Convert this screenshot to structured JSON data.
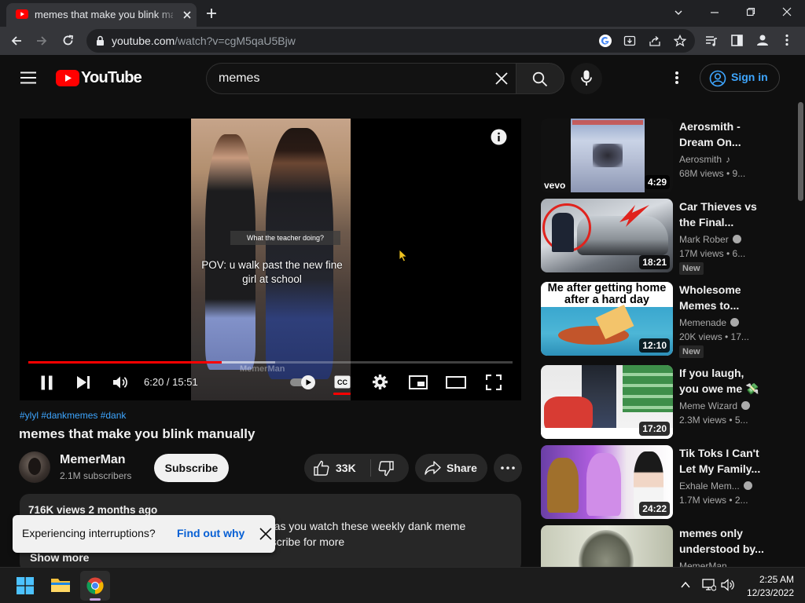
{
  "browser": {
    "tab_title": "memes that make you blink manually - YouTube",
    "url_host": "youtube.com",
    "url_path": "/watch?v=cgM5qaU5Bjw"
  },
  "youtube": {
    "logo_text": "YouTube",
    "search_query": "memes",
    "signin_label": "Sign in"
  },
  "player": {
    "caption_top": "What the teacher doing?",
    "caption_main": "POV: u walk past the new fine girl at school",
    "watermark": "MemerMan",
    "time_current": "6:20",
    "time_total": "15:51",
    "time_label": "6:20 / 15:51",
    "progress_fraction": 0.4,
    "buffer_fraction": 0.51,
    "cc_enabled": true
  },
  "video": {
    "hashtags": "#ylyl #dankmemes #dank",
    "title": "memes that make you blink manually",
    "channel_name": "MemerMan",
    "subscribers": "2.1M subscribers",
    "subscribe_label": "Subscribe",
    "like_count": "33K",
    "share_label": "Share",
    "desc_meta": "716K views  2 months ago",
    "desc_line1": "h as you watch these weekly dank meme",
    "desc_line2": "bscribe for more",
    "show_more": "Show more"
  },
  "toast": {
    "text": "Experiencing interruptions?",
    "link": "Find out why"
  },
  "recommendations": [
    {
      "title": "Aerosmith - Dream On...",
      "channel": "Aerosmith",
      "channel_mark": "music-note-icon",
      "stats": "68M views  • 9...",
      "duration": "4:29",
      "is_new": false,
      "thumb_text": "vevo"
    },
    {
      "title": "Car Thieves vs the Final...",
      "channel": "Mark Rober",
      "channel_mark": "verified-icon",
      "stats": "17M views  • 6...",
      "duration": "18:21",
      "is_new": true,
      "new_label": "New"
    },
    {
      "title": "Wholesome Memes to...",
      "channel": "Memenade",
      "channel_mark": "verified-icon",
      "stats": "20K views  • 17...",
      "duration": "12:10",
      "is_new": true,
      "new_label": "New",
      "thumb_text": "Me after getting home after a hard day"
    },
    {
      "title": "If you laugh, you owe me",
      "channel": "Meme Wizard",
      "channel_mark": "verified-icon",
      "stats": "2.3M views  • 5...",
      "duration": "17:20",
      "is_new": false
    },
    {
      "title": "Tik Toks I Can't Let My Family...",
      "channel": "Exhale Mem...",
      "channel_mark": "verified-icon",
      "stats": "1.7M views  • 2...",
      "duration": "24:22",
      "is_new": false
    },
    {
      "title": "memes only understood by...",
      "channel": "MemerMan",
      "stats": "",
      "duration": "",
      "is_new": false
    }
  ],
  "taskbar": {
    "time": "2:25 AM",
    "date": "12/23/2022"
  },
  "colors": {
    "youtube_red": "#ff0000",
    "link_blue": "#3ea6ff",
    "background": "#0f0f0f"
  }
}
